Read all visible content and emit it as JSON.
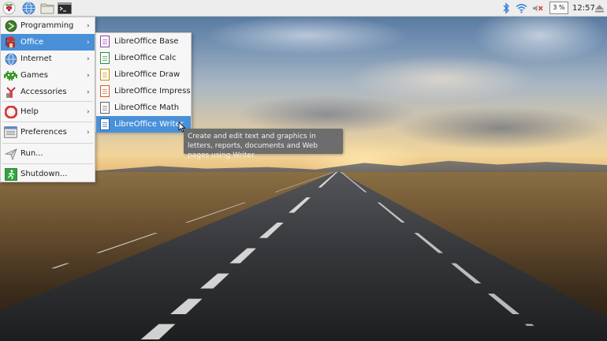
{
  "taskbar": {
    "launchers": [
      {
        "name": "raspberry-menu-icon"
      },
      {
        "name": "web-browser-icon"
      },
      {
        "name": "file-manager-icon"
      },
      {
        "name": "terminal-icon"
      }
    ],
    "cpu_usage": "3 %",
    "clock": "12:57",
    "tray_icons": [
      "bluetooth-icon",
      "wifi-icon",
      "volume-muted-icon",
      "eject-icon"
    ]
  },
  "menu": {
    "items": [
      {
        "label": "Programming",
        "icon": "programming-icon",
        "has_submenu": true
      },
      {
        "label": "Office",
        "icon": "office-icon",
        "has_submenu": true,
        "active": true
      },
      {
        "label": "Internet",
        "icon": "internet-icon",
        "has_submenu": true
      },
      {
        "label": "Games",
        "icon": "games-icon",
        "has_submenu": true
      },
      {
        "label": "Accessories",
        "icon": "accessories-icon",
        "has_submenu": true
      },
      {
        "label": "Help",
        "icon": "help-icon",
        "has_submenu": true
      },
      {
        "label": "Preferences",
        "icon": "preferences-icon",
        "has_submenu": true
      },
      {
        "label": "Run...",
        "icon": "run-icon",
        "has_submenu": false
      },
      {
        "label": "Shutdown...",
        "icon": "shutdown-icon",
        "has_submenu": false
      }
    ],
    "submenu_arrow": "›"
  },
  "office_submenu": {
    "items": [
      {
        "label": "LibreOffice Base",
        "icon": "libreoffice-base-icon",
        "color": "#8e3fa8"
      },
      {
        "label": "LibreOffice Calc",
        "icon": "libreoffice-calc-icon",
        "color": "#2e8b3d"
      },
      {
        "label": "LibreOffice Draw",
        "icon": "libreoffice-draw-icon",
        "color": "#c58a12"
      },
      {
        "label": "LibreOffice Impress",
        "icon": "libreoffice-impress-icon",
        "color": "#d0601c"
      },
      {
        "label": "LibreOffice Math",
        "icon": "libreoffice-math-icon",
        "color": "#666666"
      },
      {
        "label": "LibreOffice Writer",
        "icon": "libreoffice-writer-icon",
        "color": "#2a62b0",
        "active": true
      }
    ]
  },
  "tooltip": {
    "text": "Create and edit text and graphics in letters, reports, documents and Web pages using Writer."
  },
  "colors": {
    "highlight": "#4a90d9",
    "panel": "#ededed"
  }
}
